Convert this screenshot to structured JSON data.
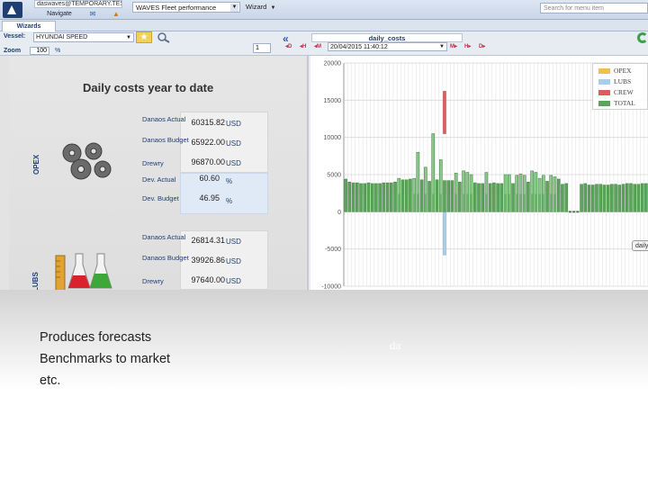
{
  "topbar": {
    "user": "daswaves@TEMPORARY.TEST.C",
    "navigate_label": "Navigate",
    "app_selected": "WAVES Fleet performance",
    "wizard_label": "Wizard",
    "menu_search_placeholder": "Search for menu item"
  },
  "tabs": {
    "wizards_label": "Wizards"
  },
  "toolbar": {
    "vessel_label": "Vessel:",
    "vessel_value": "HYUNDAI SPEED",
    "zoom_label": "Zoom",
    "zoom_value": "100",
    "zoom_unit": "%",
    "page_value": "1",
    "chart_name": "daily_costs",
    "nav_d": "D",
    "nav_h": "H",
    "nav_m": "M",
    "date_value": "20/04/2015 11:40:12",
    "nav_m2": "M",
    "nav_d2": "D"
  },
  "panel": {
    "title": "Daily costs year to date",
    "opex_label": "OPEX",
    "lubs_label": "LUBS",
    "opex": {
      "danaos_actual_label": "Danaos Actual",
      "danaos_actual": "60315.82",
      "danaos_budget_label": "Danaos Budget",
      "danaos_budget": "65922.00",
      "drewry_label": "Drewry",
      "drewry": "96870.00",
      "dev_actual_label": "Dev. Actual",
      "dev_actual": "60.60",
      "dev_budget_label": "Dev. Budget",
      "dev_budget": "46.95",
      "currency": "USD",
      "percent": "%"
    },
    "lubs": {
      "danaos_actual_label": "Danaos Actual",
      "danaos_actual": "26814.31",
      "danaos_budget_label": "Danaos Budget",
      "danaos_budget": "39926.86",
      "drewry_label": "Drewry",
      "drewry": "97640.00",
      "currency": "USD"
    }
  },
  "chart_data": {
    "type": "bar",
    "stacked": true,
    "ylim": [
      -10000,
      20000
    ],
    "yticks": [
      "20000",
      "15000",
      "10000",
      "5000",
      "0",
      "-5000",
      "-10000"
    ],
    "grid": true,
    "legend_position": "top-right",
    "legend": [
      "OPEX",
      "LUBS",
      "CREW",
      "TOTAL"
    ],
    "colors": {
      "OPEX": "#f0c050",
      "LUBS": "#a9cfe8",
      "CREW": "#d95f5f",
      "TOTAL": "#5aa55a",
      "TOTAL_light": "#8cc98c"
    },
    "series": [
      {
        "name": "TOTAL",
        "values": [
          4400,
          4000,
          3900,
          3900,
          3800,
          3800,
          3900,
          3800,
          3800,
          3800,
          3900,
          3900,
          3900,
          4000,
          4500,
          4300,
          4300,
          4400,
          4500,
          8000,
          4300,
          6000,
          4100,
          10500,
          4300,
          7000,
          4200,
          4200,
          4200,
          5200,
          4000,
          5500,
          5300,
          5000,
          3900,
          3800,
          3800,
          5300,
          3800,
          3900,
          3800,
          3800,
          5000,
          5000,
          3800,
          4900,
          5100,
          4900,
          4000,
          5500,
          5300,
          4500,
          4900,
          4100,
          4900,
          4700,
          4400,
          3700,
          3800,
          5700,
          4000,
          3800,
          3700,
          3800,
          3600,
          3600,
          3700,
          3700,
          3600,
          3600,
          3700,
          3700,
          3600,
          3700,
          3800,
          3800,
          3700,
          3700,
          3800,
          3800
        ]
      },
      {
        "name": "CREW",
        "values": [
          0,
          0,
          0,
          0,
          0,
          0,
          0,
          0,
          0,
          0,
          0,
          0,
          0,
          0,
          0,
          0,
          0,
          0,
          0,
          0,
          0,
          0,
          0,
          0,
          0,
          0,
          0,
          0,
          0,
          0,
          0,
          0,
          0,
          0,
          0,
          0,
          0,
          0,
          0,
          0,
          0,
          0,
          0,
          0,
          0,
          0,
          0,
          0,
          0,
          0,
          0,
          0,
          0,
          0,
          0,
          0,
          0,
          0,
          0,
          0,
          0,
          0,
          0,
          0,
          0,
          0,
          0,
          0,
          0,
          0,
          0,
          0,
          0,
          0,
          0,
          0,
          0,
          0,
          0,
          0
        ]
      },
      {
        "name": "LUBS",
        "values": [
          0,
          0,
          0,
          0,
          0,
          0,
          0,
          0,
          0,
          0,
          0,
          0,
          0,
          0,
          0,
          0,
          0,
          0,
          0,
          0,
          0,
          0,
          0,
          0,
          0,
          0,
          0,
          0,
          0,
          0,
          0,
          0,
          0,
          0,
          0,
          0,
          0,
          0,
          0,
          0,
          0,
          0,
          0,
          0,
          0,
          0,
          0,
          0,
          0,
          0,
          0,
          0,
          0,
          0,
          0,
          0,
          0,
          0,
          0,
          0,
          0,
          0,
          0,
          0,
          0,
          0,
          0,
          0,
          0,
          0,
          0,
          0,
          0,
          0,
          0,
          0,
          0,
          0,
          0,
          0
        ]
      }
    ],
    "spike": {
      "index": 26,
      "total": 10500,
      "crew_top": 16200,
      "lubs_bottom": -5800
    },
    "zero_days": [
      59,
      60,
      61
    ]
  },
  "caption": {
    "lines": [
      "Produces  forecasts",
      "Benchmarks to market",
      "etc."
    ],
    "ghost": "da"
  },
  "tooltip": {
    "label": "daily"
  }
}
